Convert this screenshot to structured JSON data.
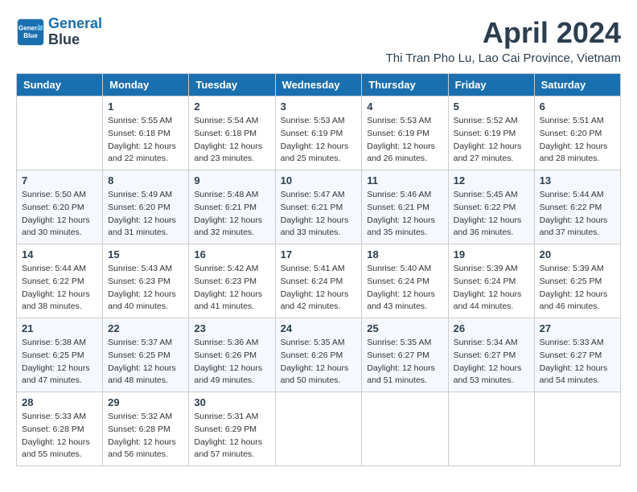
{
  "header": {
    "logo_line1": "General",
    "logo_line2": "Blue",
    "month_title": "April 2024",
    "location": "Thi Tran Pho Lu, Lao Cai Province, Vietnam"
  },
  "days_of_week": [
    "Sunday",
    "Monday",
    "Tuesday",
    "Wednesday",
    "Thursday",
    "Friday",
    "Saturday"
  ],
  "weeks": [
    [
      {
        "day": "",
        "info": ""
      },
      {
        "day": "1",
        "info": "Sunrise: 5:55 AM\nSunset: 6:18 PM\nDaylight: 12 hours\nand 22 minutes."
      },
      {
        "day": "2",
        "info": "Sunrise: 5:54 AM\nSunset: 6:18 PM\nDaylight: 12 hours\nand 23 minutes."
      },
      {
        "day": "3",
        "info": "Sunrise: 5:53 AM\nSunset: 6:19 PM\nDaylight: 12 hours\nand 25 minutes."
      },
      {
        "day": "4",
        "info": "Sunrise: 5:53 AM\nSunset: 6:19 PM\nDaylight: 12 hours\nand 26 minutes."
      },
      {
        "day": "5",
        "info": "Sunrise: 5:52 AM\nSunset: 6:19 PM\nDaylight: 12 hours\nand 27 minutes."
      },
      {
        "day": "6",
        "info": "Sunrise: 5:51 AM\nSunset: 6:20 PM\nDaylight: 12 hours\nand 28 minutes."
      }
    ],
    [
      {
        "day": "7",
        "info": "Sunrise: 5:50 AM\nSunset: 6:20 PM\nDaylight: 12 hours\nand 30 minutes."
      },
      {
        "day": "8",
        "info": "Sunrise: 5:49 AM\nSunset: 6:20 PM\nDaylight: 12 hours\nand 31 minutes."
      },
      {
        "day": "9",
        "info": "Sunrise: 5:48 AM\nSunset: 6:21 PM\nDaylight: 12 hours\nand 32 minutes."
      },
      {
        "day": "10",
        "info": "Sunrise: 5:47 AM\nSunset: 6:21 PM\nDaylight: 12 hours\nand 33 minutes."
      },
      {
        "day": "11",
        "info": "Sunrise: 5:46 AM\nSunset: 6:21 PM\nDaylight: 12 hours\nand 35 minutes."
      },
      {
        "day": "12",
        "info": "Sunrise: 5:45 AM\nSunset: 6:22 PM\nDaylight: 12 hours\nand 36 minutes."
      },
      {
        "day": "13",
        "info": "Sunrise: 5:44 AM\nSunset: 6:22 PM\nDaylight: 12 hours\nand 37 minutes."
      }
    ],
    [
      {
        "day": "14",
        "info": "Sunrise: 5:44 AM\nSunset: 6:22 PM\nDaylight: 12 hours\nand 38 minutes."
      },
      {
        "day": "15",
        "info": "Sunrise: 5:43 AM\nSunset: 6:23 PM\nDaylight: 12 hours\nand 40 minutes."
      },
      {
        "day": "16",
        "info": "Sunrise: 5:42 AM\nSunset: 6:23 PM\nDaylight: 12 hours\nand 41 minutes."
      },
      {
        "day": "17",
        "info": "Sunrise: 5:41 AM\nSunset: 6:24 PM\nDaylight: 12 hours\nand 42 minutes."
      },
      {
        "day": "18",
        "info": "Sunrise: 5:40 AM\nSunset: 6:24 PM\nDaylight: 12 hours\nand 43 minutes."
      },
      {
        "day": "19",
        "info": "Sunrise: 5:39 AM\nSunset: 6:24 PM\nDaylight: 12 hours\nand 44 minutes."
      },
      {
        "day": "20",
        "info": "Sunrise: 5:39 AM\nSunset: 6:25 PM\nDaylight: 12 hours\nand 46 minutes."
      }
    ],
    [
      {
        "day": "21",
        "info": "Sunrise: 5:38 AM\nSunset: 6:25 PM\nDaylight: 12 hours\nand 47 minutes."
      },
      {
        "day": "22",
        "info": "Sunrise: 5:37 AM\nSunset: 6:25 PM\nDaylight: 12 hours\nand 48 minutes."
      },
      {
        "day": "23",
        "info": "Sunrise: 5:36 AM\nSunset: 6:26 PM\nDaylight: 12 hours\nand 49 minutes."
      },
      {
        "day": "24",
        "info": "Sunrise: 5:35 AM\nSunset: 6:26 PM\nDaylight: 12 hours\nand 50 minutes."
      },
      {
        "day": "25",
        "info": "Sunrise: 5:35 AM\nSunset: 6:27 PM\nDaylight: 12 hours\nand 51 minutes."
      },
      {
        "day": "26",
        "info": "Sunrise: 5:34 AM\nSunset: 6:27 PM\nDaylight: 12 hours\nand 53 minutes."
      },
      {
        "day": "27",
        "info": "Sunrise: 5:33 AM\nSunset: 6:27 PM\nDaylight: 12 hours\nand 54 minutes."
      }
    ],
    [
      {
        "day": "28",
        "info": "Sunrise: 5:33 AM\nSunset: 6:28 PM\nDaylight: 12 hours\nand 55 minutes."
      },
      {
        "day": "29",
        "info": "Sunrise: 5:32 AM\nSunset: 6:28 PM\nDaylight: 12 hours\nand 56 minutes."
      },
      {
        "day": "30",
        "info": "Sunrise: 5:31 AM\nSunset: 6:29 PM\nDaylight: 12 hours\nand 57 minutes."
      },
      {
        "day": "",
        "info": ""
      },
      {
        "day": "",
        "info": ""
      },
      {
        "day": "",
        "info": ""
      },
      {
        "day": "",
        "info": ""
      }
    ]
  ]
}
